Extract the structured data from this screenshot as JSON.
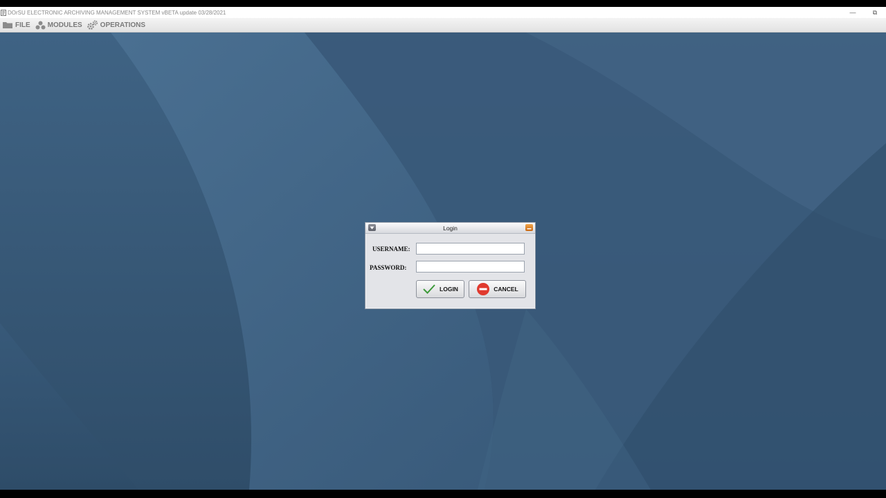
{
  "window": {
    "title": "DOrSU ELECTRONIC ARCHIVING MANAGEMENT SYSTEM vBETA update 03/28/2021",
    "minimize_glyph": "—",
    "restore_glyph": "⧉"
  },
  "menubar": {
    "items": [
      {
        "label": "FILE",
        "icon": "folder-icon"
      },
      {
        "label": "MODULES",
        "icon": "modules-icon"
      },
      {
        "label": "OPERATIONS",
        "icon": "gears-icon"
      }
    ]
  },
  "login_dialog": {
    "title": "Login",
    "username_label": "USERNAME:",
    "username_value": "",
    "password_label": "PASSWORD:",
    "password_value": "",
    "login_label": "LOGIN",
    "cancel_label": "CANCEL"
  },
  "colors": {
    "desktop": "#3d5d7c",
    "login_check": "#3d9a3a",
    "cancel_red": "#e03a2e",
    "minimize_orange": "#e08a2c"
  }
}
